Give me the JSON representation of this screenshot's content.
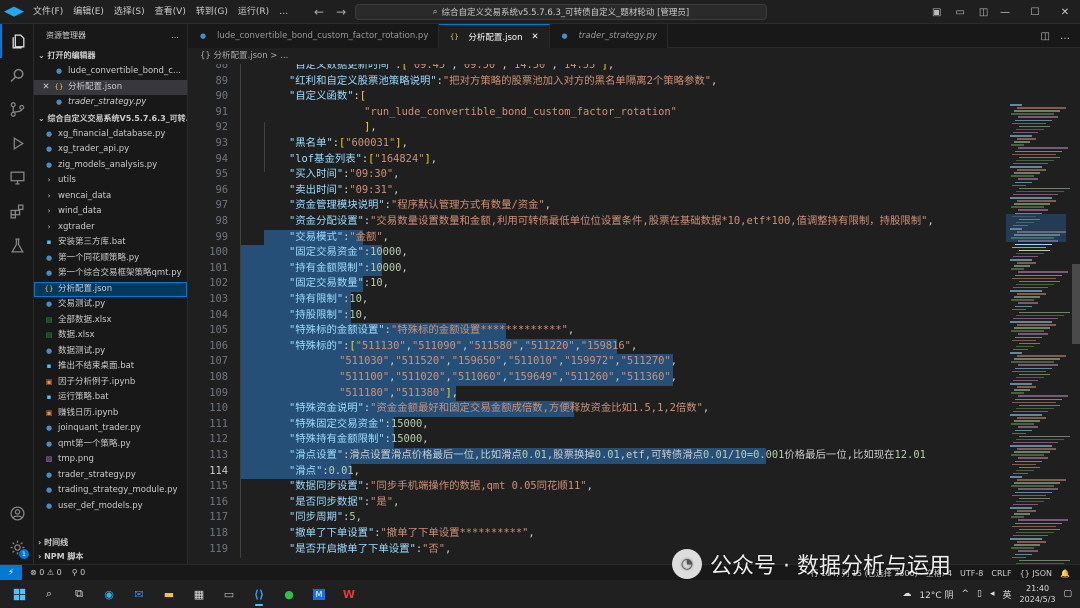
{
  "titlebar": {
    "logo": "◀▶",
    "menu": [
      "文件(F)",
      "编辑(E)",
      "选择(S)",
      "查看(V)",
      "转到(G)",
      "运行(R)",
      "…"
    ],
    "search_text": "综合自定义交易系统v5.5.7.6.3_可转债自定义_题材轮动 [管理员]"
  },
  "sidebar": {
    "title": "资源管理器",
    "open_editors_header": "打开的编辑器",
    "open_editors": [
      {
        "label": "lude_convertible_bond_c...",
        "icon": "python-icon",
        "italic": false
      },
      {
        "label": "分析配置.json",
        "icon": "json-icon",
        "italic": false,
        "selected": true
      },
      {
        "label": "trader_strategy.py",
        "icon": "python-icon",
        "italic": true
      }
    ],
    "project_header": "综合自定义交易系统V5.5.7.6.3_可转...",
    "files": [
      {
        "label": "xg_financial_database.py",
        "icon": "python-icon"
      },
      {
        "label": "xg_trader_api.py",
        "icon": "python-icon"
      },
      {
        "label": "zig_models_analysis.py",
        "icon": "python-icon"
      },
      {
        "label": "utils",
        "icon": "folder-icon"
      },
      {
        "label": "wencai_data",
        "icon": "folder-icon"
      },
      {
        "label": "wind_data",
        "icon": "folder-icon"
      },
      {
        "label": "xgtrader",
        "icon": "folder-icon"
      },
      {
        "label": "安装第三方库.bat",
        "icon": "windows-icon"
      },
      {
        "label": "第一个同花顺策略.py",
        "icon": "python-icon"
      },
      {
        "label": "第一个综合交易框架策略qmt.py",
        "icon": "python-icon"
      },
      {
        "label": "分析配置.json",
        "icon": "json-icon",
        "current": true
      },
      {
        "label": "交易测试.py",
        "icon": "python-icon"
      },
      {
        "label": "全部数据.xlsx",
        "icon": "excel-icon"
      },
      {
        "label": "数据.xlsx",
        "icon": "excel-icon"
      },
      {
        "label": "数据测试.py",
        "icon": "python-icon"
      },
      {
        "label": "推出不结束桌面.bat",
        "icon": "windows-icon"
      },
      {
        "label": "因子分析例子.ipynb",
        "icon": "notebook-icon"
      },
      {
        "label": "运行策略.bat",
        "icon": "windows-icon"
      },
      {
        "label": "赚钱日历.ipynb",
        "icon": "notebook-icon"
      },
      {
        "label": "joinquant_trader.py",
        "icon": "python-icon"
      },
      {
        "label": "qmt第一个策略.py",
        "icon": "python-icon"
      },
      {
        "label": "tmp.png",
        "icon": "image-icon"
      },
      {
        "label": "trader_strategy.py",
        "icon": "python-icon"
      },
      {
        "label": "trading_strategy_module.py",
        "icon": "python-icon"
      },
      {
        "label": "user_def_models.py",
        "icon": "python-icon"
      }
    ],
    "timeline_header": "时间线",
    "npm_header": "NPM 脚本"
  },
  "tabs": [
    {
      "label": "lude_convertible_bond_custom_factor_rotation.py",
      "icon": "python-icon",
      "active": false,
      "italic": false
    },
    {
      "label": "分析配置.json",
      "icon": "json-icon",
      "active": true,
      "italic": false
    },
    {
      "label": "trader_strategy.py",
      "icon": "python-icon",
      "active": false,
      "italic": true
    }
  ],
  "breadcrumb": "{} 分析配置.json > ...",
  "code": {
    "lines": [
      {
        "no": "88",
        "text": "    \"自定义数据更新时间\":[\"09:45\",\"09:50\",\"14:50\",\"14:55\"],",
        "sel": false
      },
      {
        "no": "89",
        "text": "    \"红利和自定义股票池策略说明\":\"把对方策略的股票池加入对方的黑名单隔离2个策略参数\",",
        "sel": false
      },
      {
        "no": "90",
        "text": "    \"自定义函数\":[",
        "sel": false
      },
      {
        "no": "91",
        "text": "                \"run_lude_convertible_bond_custom_factor_rotation\"",
        "sel": false
      },
      {
        "no": "92",
        "text": "                ],",
        "sel": false
      },
      {
        "no": "93",
        "text": "    \"黑名单\":[\"600031\"],",
        "sel": false
      },
      {
        "no": "94",
        "text": "    \"lof基金列表\":[\"164824\"],",
        "sel": false
      },
      {
        "no": "95",
        "text": "    \"买入时间\":\"09:30\",",
        "sel": false
      },
      {
        "no": "96",
        "text": "    \"卖出时间\":\"09:31\",",
        "sel": false
      },
      {
        "no": "97",
        "text": "    \"资金管理模块说明\":\"程序默认管理方式有数量/资金\",",
        "sel": false
      },
      {
        "no": "98",
        "text": "    \"资金分配设置\":\"交易数量设置数量和金额,利用可转债最低单位位设置条件,股票在基础数据*10,etf*100,值调整持有限制，持股限制\",",
        "sel": false
      },
      {
        "no": "99",
        "text": "    \"交易模式\":\"金额\",",
        "sel": true
      },
      {
        "no": "100",
        "text": "    \"固定交易资金\":10000,",
        "sel": true
      },
      {
        "no": "101",
        "text": "    \"持有金额限制\":10000,",
        "sel": true
      },
      {
        "no": "102",
        "text": "    \"固定交易数量\":10,",
        "sel": true
      },
      {
        "no": "103",
        "text": "    \"持有限制\":10,",
        "sel": true
      },
      {
        "no": "104",
        "text": "    \"持股限制\":10,",
        "sel": true
      },
      {
        "no": "105",
        "text": "    \"特殊标的金额设置\":\"特殊标的金额设置*************\",",
        "sel": true
      },
      {
        "no": "106",
        "text": "    \"特殊标的\":[\"511130\",\"511090\",\"511580\",\"511220\",\"159816\",",
        "sel": true
      },
      {
        "no": "107",
        "text": "            \"511030\",\"511520\",\"159650\",\"511010\",\"159972\",\"511270\",",
        "sel": true
      },
      {
        "no": "108",
        "text": "            \"511100\",\"511020\",\"511060\",\"159649\",\"511260\",\"511360\",",
        "sel": true
      },
      {
        "no": "109",
        "text": "            \"511180\",\"511380\"],",
        "sel": true
      },
      {
        "no": "110",
        "text": "    \"特殊资金说明\":\"资金金额最好和固定交易金额成倍数,方便释放资金比如1.5,1,2倍数\",",
        "sel": true
      },
      {
        "no": "111",
        "text": "    \"特殊固定交易资金\":15000,",
        "sel": true
      },
      {
        "no": "112",
        "text": "    \"特殊持有金额限制\":15000,",
        "sel": true
      },
      {
        "no": "113",
        "text": "    \"滑点设置\":\"滑点设置滑点价格最后一位,比如滑点0.01,股票换掉0.01,etf,可转债滑点0.01/10=0.001价格最后一位,比如现在12.01",
        "sel": true
      },
      {
        "no": "114",
        "text": "    \"滑点\":0.01,",
        "sel": true
      },
      {
        "no": "115",
        "text": "    \"数据同步设置\":\"同步手机端操作的数据,qmt 0.05同花顺11\",",
        "sel": false
      },
      {
        "no": "116",
        "text": "    \"是否同步数据\":\"是\",",
        "sel": false
      },
      {
        "no": "117",
        "text": "    \"同步周期\":5,",
        "sel": false
      },
      {
        "no": "118",
        "text": "    \"撤单了下单设置\":\"撤单了下单设置**********\",",
        "sel": false
      },
      {
        "no": "119",
        "text": "    \"是否开启撤单了下单设置\":\"否\",",
        "sel": false
      }
    ],
    "active_line": "114"
  },
  "statusbar": {
    "left": [
      "⊗ 0 ⚠ 0",
      "⚲ 0"
    ],
    "right": [
      "行 114, 列 15 (已选择 2506)",
      "空格: 4",
      "UTF-8",
      "CRLF",
      "{} JSON"
    ]
  },
  "taskbar": {
    "weather": "12°C 阴",
    "lang": "英",
    "time": "21:40",
    "date": "2024/5/3"
  },
  "watermark": "公众号 · 数据分析与运用",
  "colors": {
    "accent": "#0078d4",
    "selection": "#264f78",
    "key": "#9cdcfe",
    "string": "#ce9178",
    "number": "#b5cea8"
  }
}
